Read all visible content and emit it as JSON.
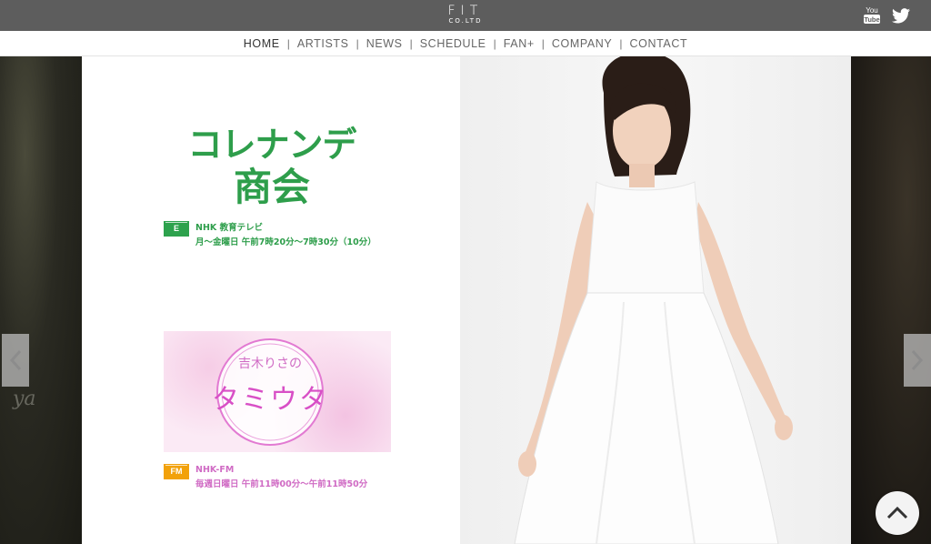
{
  "header": {
    "logo_main": "FIT",
    "logo_sub": "CO.LTD",
    "social": [
      "youtube-icon",
      "twitter-icon"
    ],
    "bg_color": "#5d5d5d"
  },
  "nav": {
    "items": [
      {
        "label": "HOME",
        "active": true
      },
      {
        "label": "ARTISTS"
      },
      {
        "label": "NEWS"
      },
      {
        "label": "SCHEDULE"
      },
      {
        "label": "FAN+"
      },
      {
        "label": "COMPANY"
      },
      {
        "label": "CONTACT"
      }
    ],
    "separator": "|"
  },
  "slide": {
    "show1": {
      "title": "コレナンデ商会",
      "channel_badge": "E",
      "station": "NHK 教育テレビ",
      "schedule": "月～金曜日 午前7時20分～7時30分（10分）",
      "color": "#2e9e4b"
    },
    "show2": {
      "title_small": "吉木りさの",
      "title_large": "タミウタ",
      "channel_badge": "FM",
      "station": "NHK-FM",
      "schedule": "毎週日曜日 午前11時00分～午前11時50分",
      "color": "#d06bc4"
    },
    "bg_left_text": "ya"
  },
  "controls": {
    "prev": "chevron-left-icon",
    "next": "chevron-right-icon",
    "to_top": "chevron-up-icon"
  }
}
